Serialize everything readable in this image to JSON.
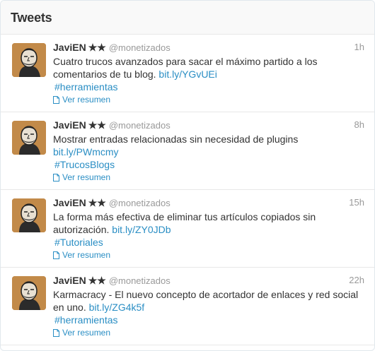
{
  "header": {
    "title": "Tweets"
  },
  "tweets": [
    {
      "fullname": "JaviEN",
      "badge": "★★",
      "username": "@monetizados",
      "time": "1h",
      "text": "Cuatro trucos avanzados para sacar el máximo partido a los comentarios de tu blog.",
      "link": "bit.ly/YGvUEi",
      "hashtag": "#herramientas",
      "summary_label": "Ver resumen"
    },
    {
      "fullname": "JaviEN",
      "badge": "★★",
      "username": "@monetizados",
      "time": "8h",
      "text": "Mostrar entradas relacionadas sin necesidad de plugins",
      "link": "bit.ly/PWmcmy",
      "hashtag": "#TrucosBlogs",
      "summary_label": "Ver resumen"
    },
    {
      "fullname": "JaviEN",
      "badge": "★★",
      "username": "@monetizados",
      "time": "15h",
      "text": "La forma más efectiva de eliminar tus artículos copiados sin autorización.",
      "link": "bit.ly/ZY0JDb",
      "hashtag": "#Tutoriales",
      "summary_label": "Ver resumen"
    },
    {
      "fullname": "JaviEN",
      "badge": "★★",
      "username": "@monetizados",
      "time": "22h",
      "text": "Karmacracy - El nuevo concepto de acortador de enlaces y red social en uno.",
      "link": "bit.ly/ZG4k5f",
      "hashtag": "#herramientas",
      "summary_label": "Ver resumen"
    }
  ],
  "colors": {
    "link": "#2a8ec4",
    "meta": "#999999",
    "text": "#333333",
    "avatar_bg": "#c28a49"
  },
  "icons": {
    "avatar": "avatar-illustration",
    "summary": "document-icon"
  }
}
